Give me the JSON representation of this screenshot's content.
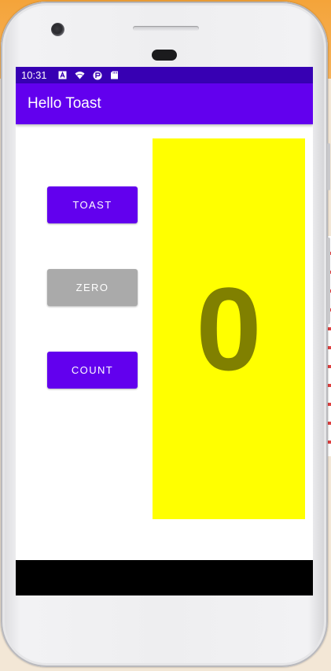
{
  "status_bar": {
    "time": "10:31",
    "icons": [
      "a-notification-icon",
      "wifi-icon",
      "app-notification-icon",
      "sd-card-icon"
    ],
    "color": "#3700b3"
  },
  "app_bar": {
    "title": "Hello Toast",
    "color": "#6200ee"
  },
  "buttons": {
    "toast_label": "TOAST",
    "zero_label": "ZERO",
    "count_label": "COUNT",
    "primary_color": "#6200ee",
    "disabled_color": "#aaaaaa"
  },
  "counter": {
    "value": "0",
    "background_color": "#ffff00",
    "text_color": "#808000"
  }
}
